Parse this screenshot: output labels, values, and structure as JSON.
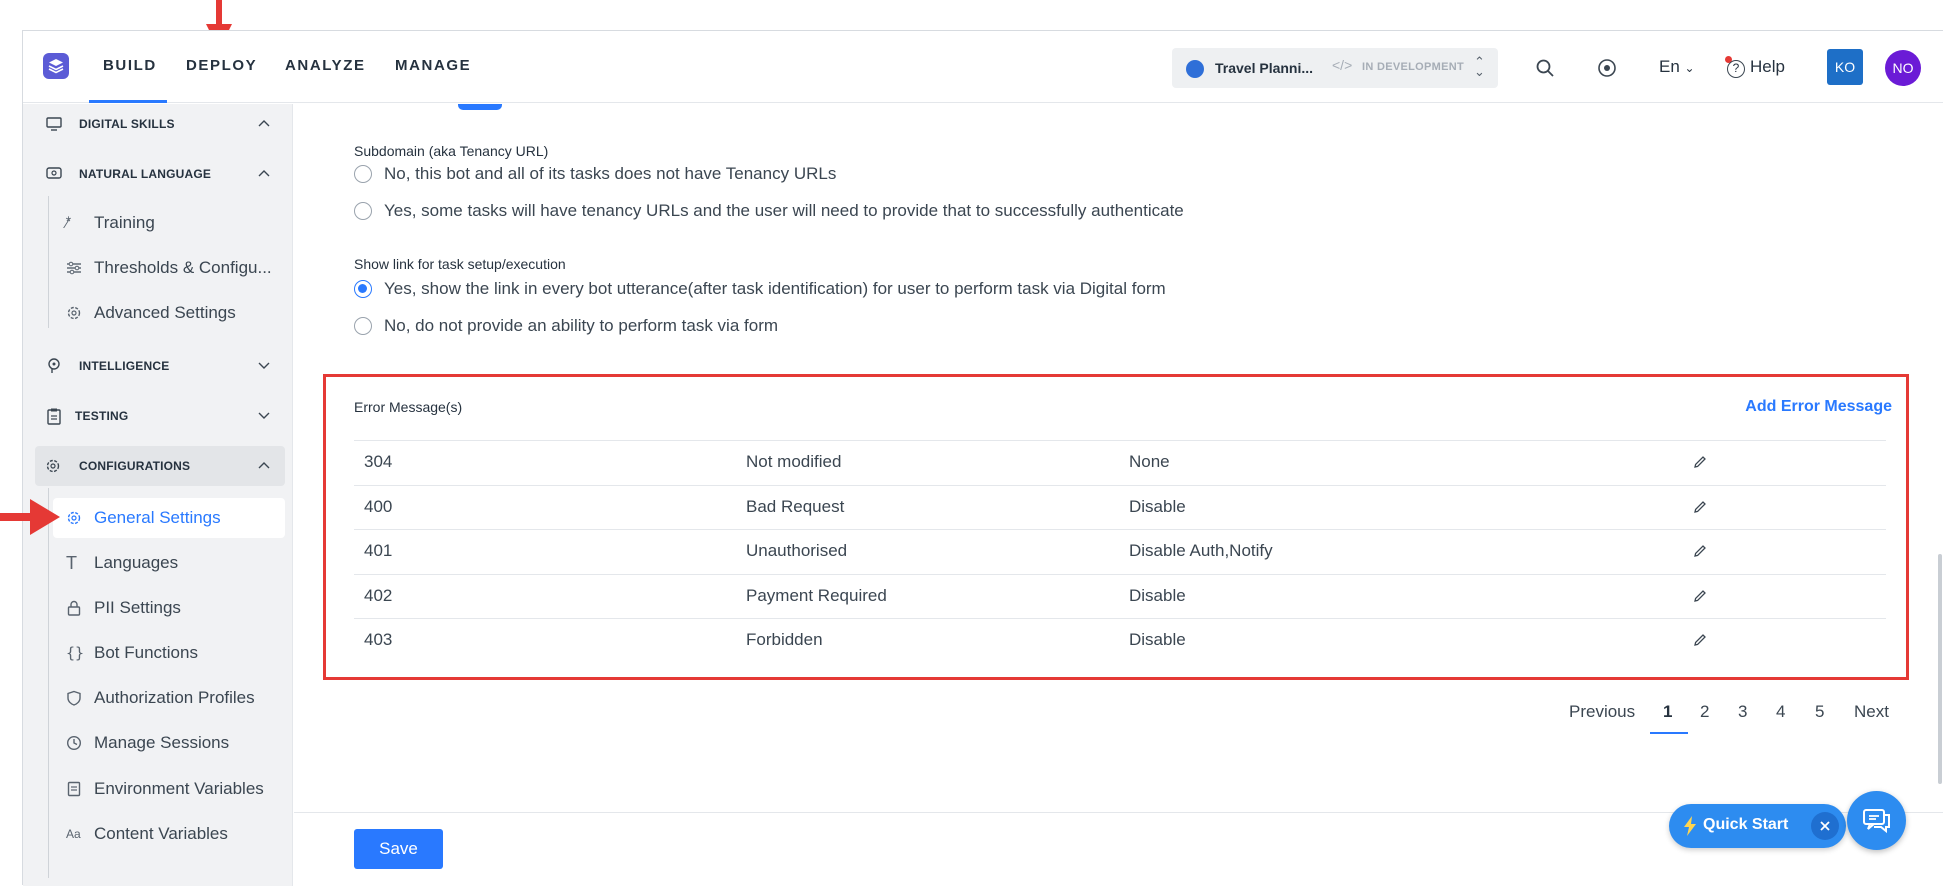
{
  "nav": {
    "tabs": [
      "BUILD",
      "DEPLOY",
      "ANALYZE",
      "MANAGE"
    ],
    "bot": {
      "name": "Travel Planni...",
      "status": "IN DEVELOPMENT"
    },
    "lang": "En",
    "help": "Help",
    "avatar_1": "KO",
    "avatar_2": "NO"
  },
  "sidebar": {
    "groups": {
      "digital_skills": "DIGITAL SKILLS",
      "natural_language": "NATURAL LANGUAGE",
      "intelligence": "INTELLIGENCE",
      "testing": "TESTING",
      "configurations": "CONFIGURATIONS"
    },
    "nl_items": [
      "Training",
      "Thresholds & Configu...",
      "Advanced Settings"
    ],
    "config_items": [
      "General Settings",
      "Languages",
      "PII Settings",
      "Bot Functions",
      "Authorization Profiles",
      "Manage Sessions",
      "Environment Variables",
      "Content Variables"
    ]
  },
  "subdomain": {
    "label": "Subdomain (aka Tenancy URL)",
    "options": [
      "No, this bot and all of its tasks does not have Tenancy URLs",
      "Yes, some tasks will have tenancy URLs and the user will need to provide that to successfully authenticate"
    ]
  },
  "show_link": {
    "label": "Show link for task setup/execution",
    "options": [
      "Yes, show the link in every bot utterance(after task identification) for user to perform task via Digital form",
      "No, do not provide an ability to perform task via form"
    ]
  },
  "errors": {
    "title": "Error Message(s)",
    "add_label": "Add Error Message",
    "rows": [
      {
        "code": "304",
        "name": "Not modified",
        "action": "None"
      },
      {
        "code": "400",
        "name": "Bad Request",
        "action": "Disable"
      },
      {
        "code": "401",
        "name": "Unauthorised",
        "action": "Disable Auth,Notify"
      },
      {
        "code": "402",
        "name": "Payment Required",
        "action": "Disable"
      },
      {
        "code": "403",
        "name": "Forbidden",
        "action": "Disable"
      }
    ]
  },
  "pagination": {
    "previous": "Previous",
    "pages": [
      "1",
      "2",
      "3",
      "4",
      "5"
    ],
    "next": "Next",
    "current": "1"
  },
  "footer": {
    "save": "Save",
    "quick_start": "Quick Start"
  },
  "colors": {
    "accent": "#2979ff",
    "highlight_box": "#e53935",
    "annotation_arrow": "#e53935"
  }
}
